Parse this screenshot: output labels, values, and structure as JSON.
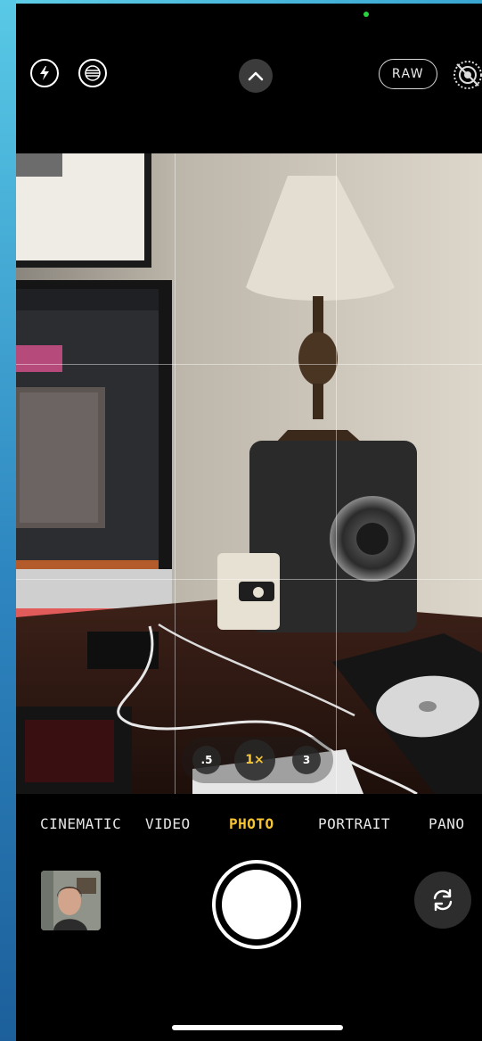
{
  "camera": {
    "top_controls": {
      "flash_icon": "flash-icon",
      "style_icon": "photographic-style-icon",
      "chevron_icon": "chevron-up-icon",
      "raw_label": "RAW",
      "live_icon": "live-photo-off-icon"
    },
    "zoom": {
      "options": [
        ".5",
        "1×",
        "3"
      ],
      "selected": "1×"
    },
    "modes": [
      "CINEMATIC",
      "VIDEO",
      "PHOTO",
      "PORTRAIT",
      "PANO"
    ],
    "active_mode": "PHOTO",
    "bottom": {
      "thumbnail_icon": "last-photo-thumbnail",
      "shutter_icon": "shutter-button",
      "flip_icon": "switch-camera-icon"
    }
  },
  "colors": {
    "accent": "#f6c531",
    "indicator": "#2bd13c",
    "background": "#000000"
  }
}
